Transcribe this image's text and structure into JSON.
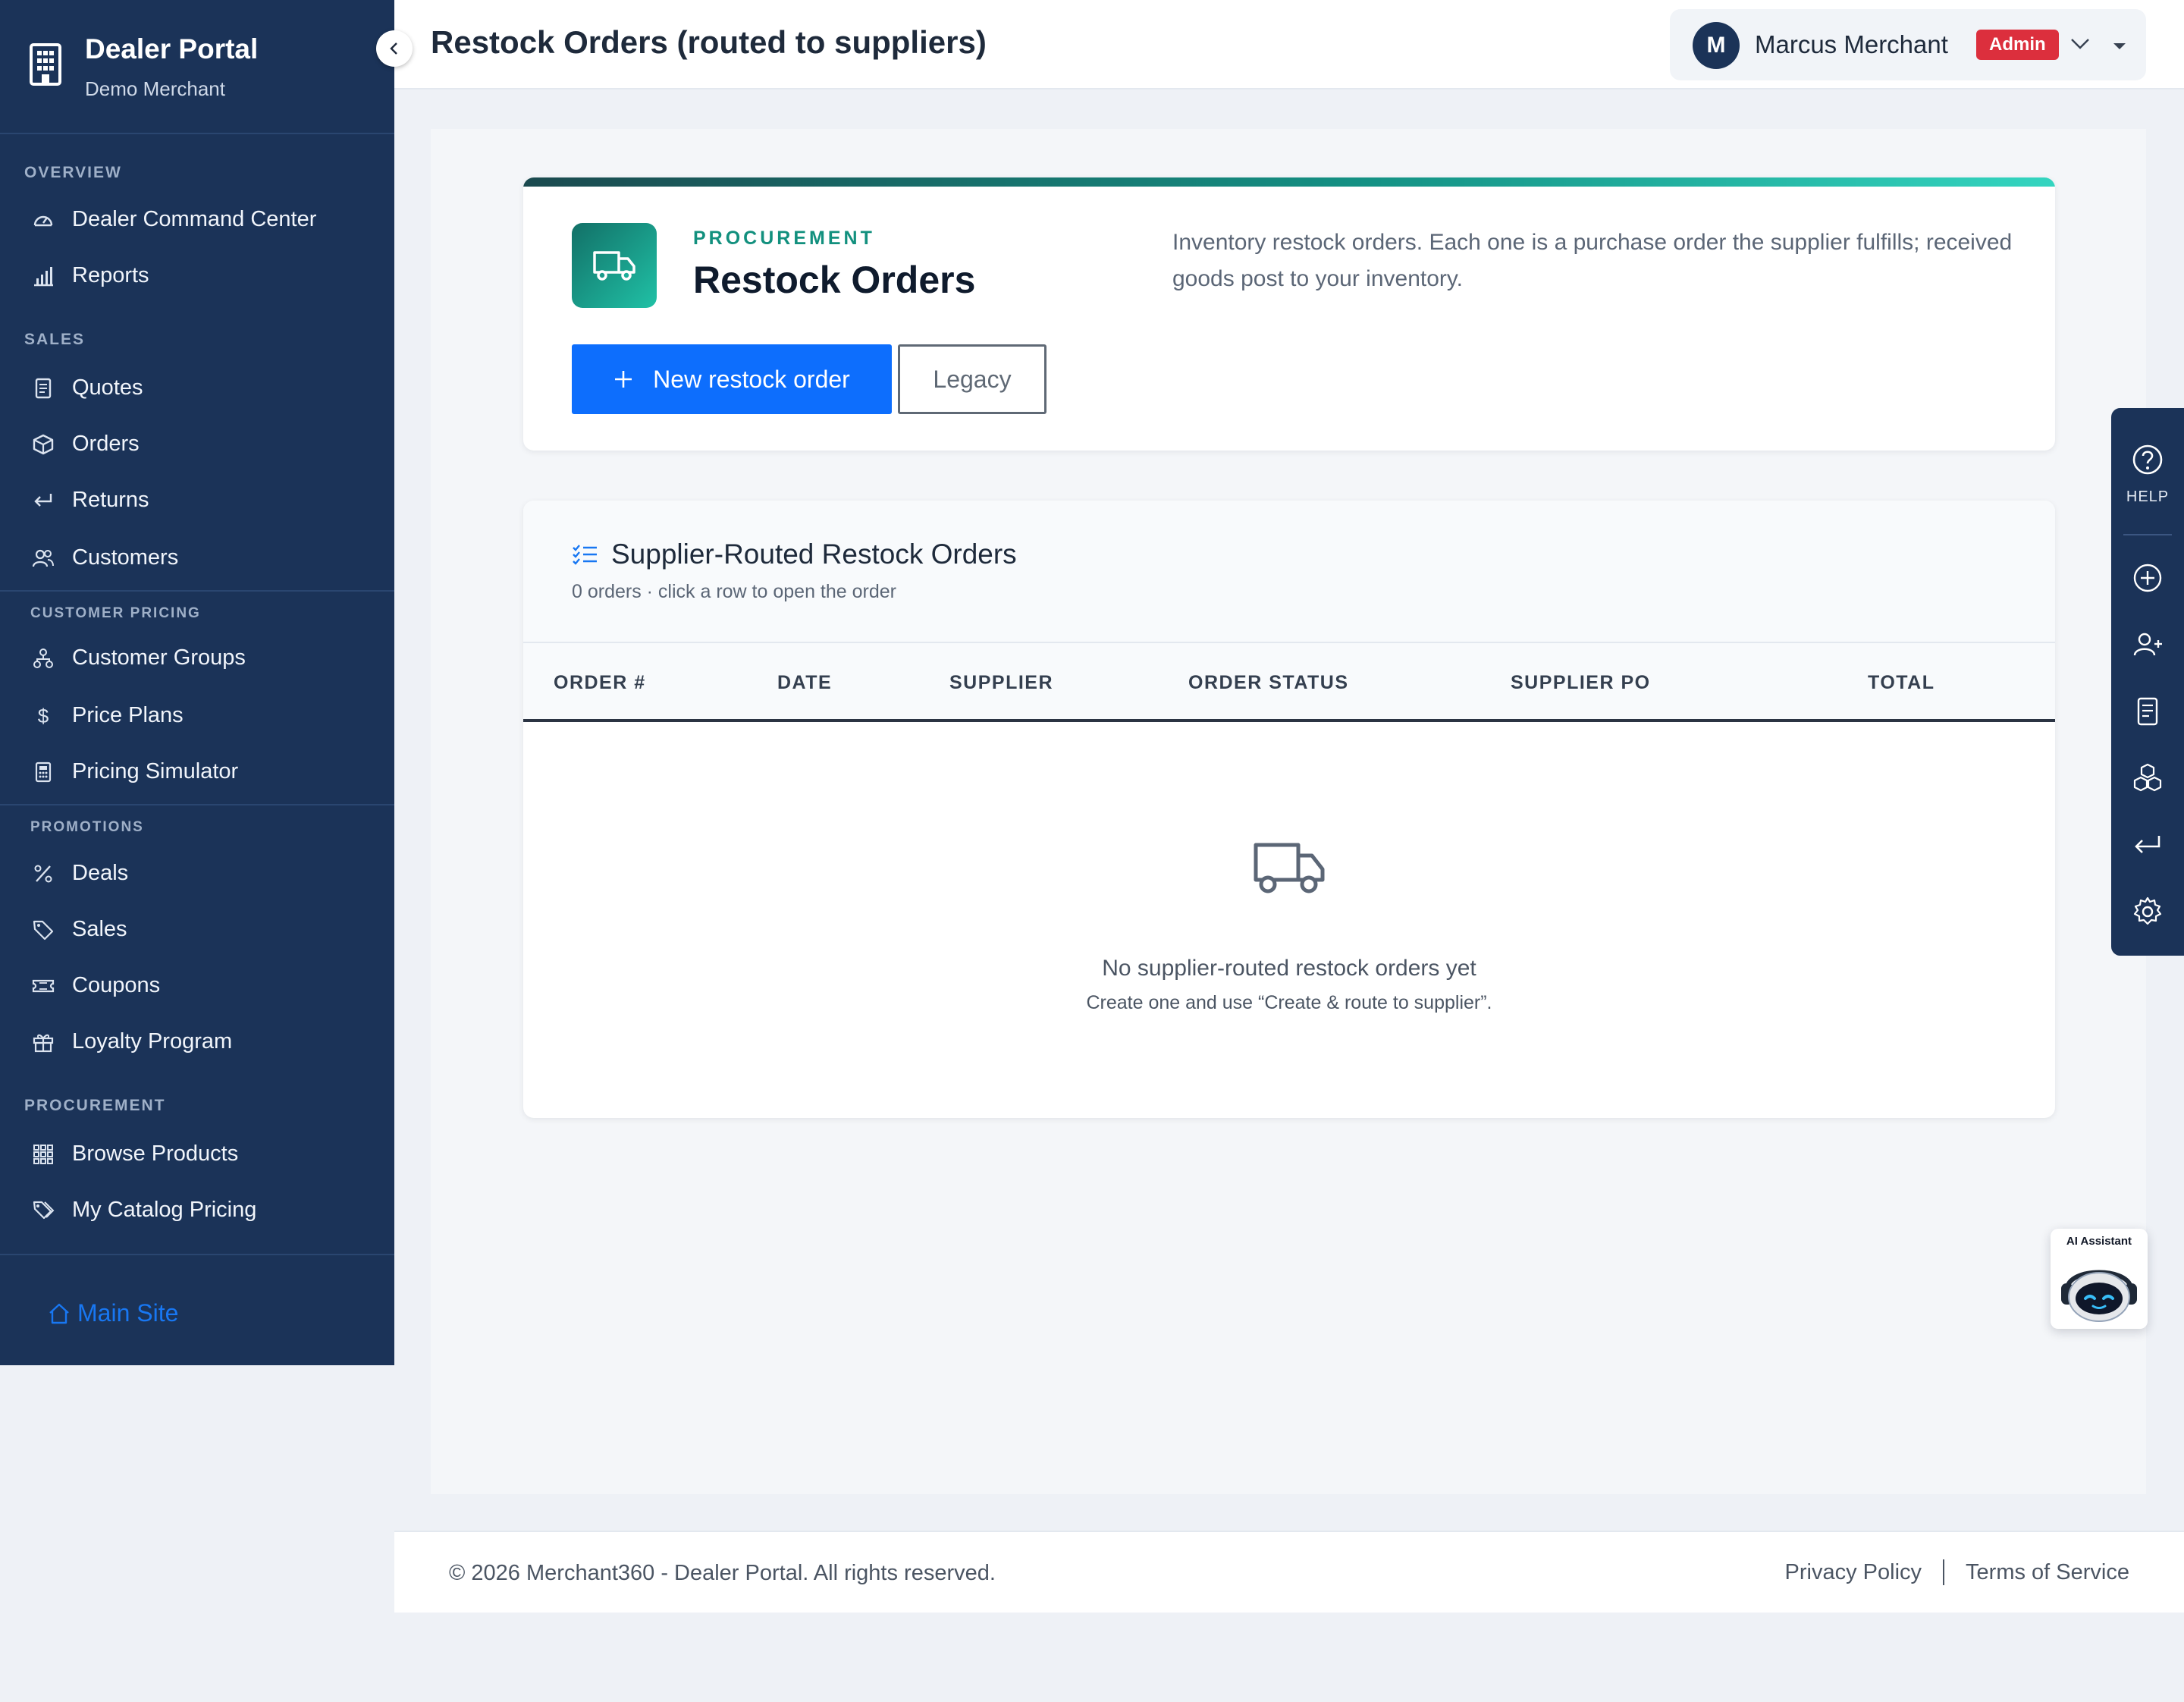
{
  "brand": {
    "title": "Dealer Portal",
    "subtitle": "Demo Merchant"
  },
  "topbar": {
    "title": "Restock Orders (routed to suppliers)",
    "user": {
      "initial": "M",
      "name": "Marcus Merchant",
      "role": "Admin"
    }
  },
  "sidebar": {
    "sections": {
      "overview": "OVERVIEW",
      "sales": "SALES",
      "customer_pricing": "CUSTOMER PRICING",
      "promotions": "PROMOTIONS",
      "procurement": "PROCUREMENT"
    },
    "items": [
      {
        "label": "Dealer Command Center",
        "icon": "gauge-icon"
      },
      {
        "label": "Reports",
        "icon": "bar-chart-icon"
      },
      {
        "label": "Quotes",
        "icon": "document-icon"
      },
      {
        "label": "Orders",
        "icon": "box-icon"
      },
      {
        "label": "Returns",
        "icon": "return-arrow-icon"
      },
      {
        "label": "Customers",
        "icon": "users-icon"
      },
      {
        "label": "Customer Groups",
        "icon": "hierarchy-icon"
      },
      {
        "label": "Price Plans",
        "icon": "dollar-icon"
      },
      {
        "label": "Pricing Simulator",
        "icon": "calculator-icon"
      },
      {
        "label": "Deals",
        "icon": "percent-icon"
      },
      {
        "label": "Sales",
        "icon": "tag-icon"
      },
      {
        "label": "Coupons",
        "icon": "ticket-icon"
      },
      {
        "label": "Loyalty Program",
        "icon": "gift-icon"
      },
      {
        "label": "Browse Products",
        "icon": "grid-icon"
      },
      {
        "label": "My Catalog Pricing",
        "icon": "tags-icon"
      }
    ],
    "footer_link": "Main Site"
  },
  "hero": {
    "eyebrow": "PROCUREMENT",
    "title": "Restock Orders",
    "description": "Inventory restock orders. Each one is a purchase order the supplier fulfills; received goods post to your inventory.",
    "primary_button": "New restock order",
    "secondary_button": "Legacy"
  },
  "orders_table": {
    "title": "Supplier-Routed Restock Orders",
    "subtitle": "0 orders · click a row to open the order",
    "columns": [
      "ORDER #",
      "DATE",
      "SUPPLIER",
      "ORDER STATUS",
      "SUPPLIER PO",
      "TOTAL"
    ],
    "rows": [],
    "empty_title": "No supplier-routed restock orders yet",
    "empty_subtitle": "Create one and use “Create & route to supplier”."
  },
  "right_rail": {
    "help_label": "HELP",
    "items": [
      "add-circle-icon",
      "add-user-icon",
      "document-icon",
      "boxes-icon",
      "return-arrow-icon",
      "gear-icon"
    ]
  },
  "assistant": {
    "label": "AI Assistant"
  },
  "footer": {
    "copyright": "© 2026 Merchant360 - Dealer Portal. All rights reserved.",
    "links": [
      "Privacy Policy",
      "Terms of Service"
    ]
  },
  "colors": {
    "sidebar": "#1b3358",
    "primary": "#0d6efd",
    "accent": "#12907e",
    "danger": "#dc2f3d"
  }
}
